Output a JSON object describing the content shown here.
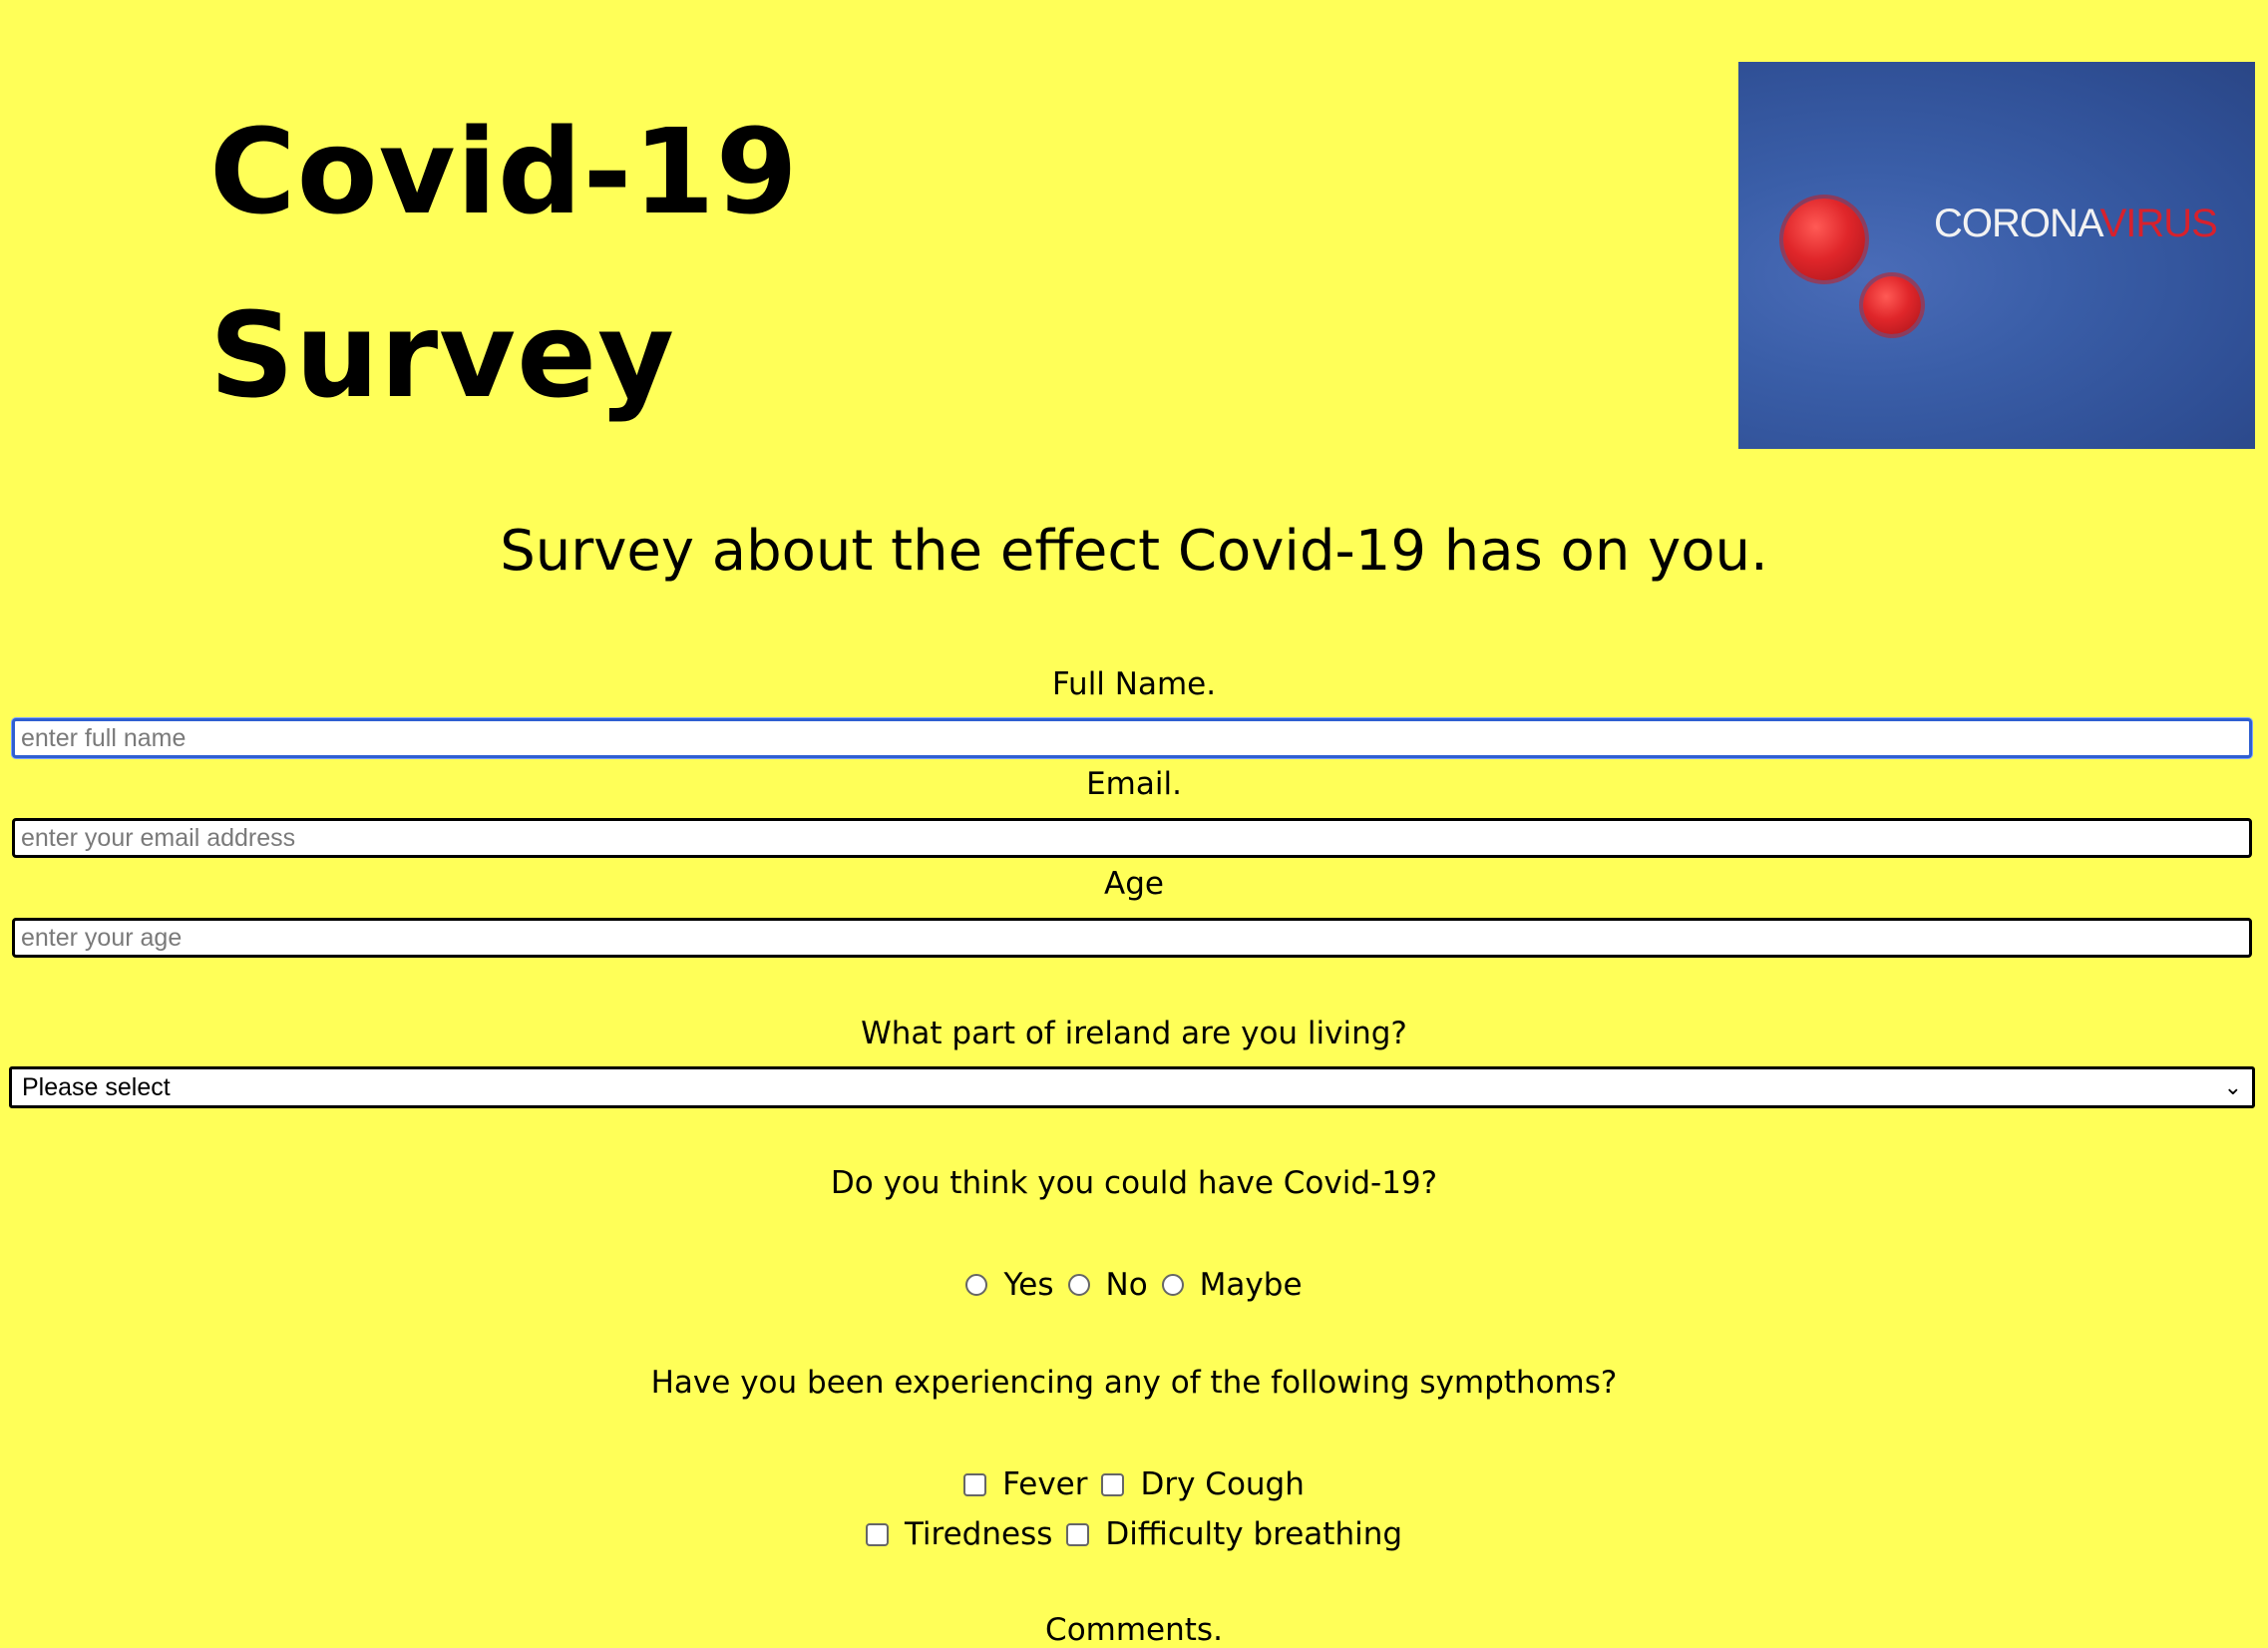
{
  "header": {
    "title_line1": "Covid-19",
    "title_line2": "Survey",
    "banner": {
      "word_light": "CORONA",
      "word_red": "VIRUS"
    }
  },
  "subtitle": "Survey about the effect Covid-19 has on you.",
  "form": {
    "name": {
      "label": "Full Name.",
      "placeholder": "enter full name",
      "value": ""
    },
    "email": {
      "label": "Email.",
      "placeholder": "enter your email address",
      "value": ""
    },
    "age": {
      "label": "Age",
      "placeholder": "enter your age",
      "value": ""
    },
    "region": {
      "label": "What part of ireland are you living?",
      "selected": "Please select"
    },
    "covid": {
      "question": "Do you think you could have Covid-19?",
      "options": [
        "Yes",
        "No",
        "Maybe"
      ]
    },
    "symptoms": {
      "question": "Have you been experiencing any of the following sympthoms?",
      "options": [
        "Fever",
        "Dry Cough",
        "Tiredness",
        "Difficulty breathing"
      ]
    },
    "comments": {
      "label": "Comments."
    }
  },
  "colors": {
    "background": "#ffff58",
    "banner": "#3a5ea8",
    "virus": "#e0262a",
    "focus": "#2f5fd1"
  }
}
